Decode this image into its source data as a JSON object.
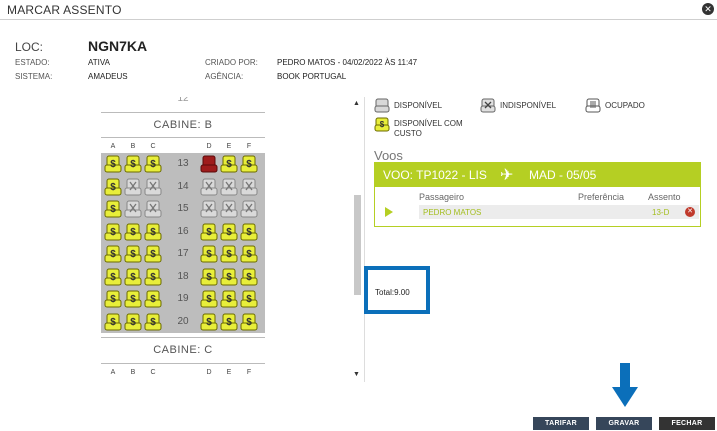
{
  "window": {
    "title": "MARCAR ASSENTO",
    "close_icon": "close-circle-icon"
  },
  "booking": {
    "loc_label": "LOC:",
    "loc_value": "NGN7KA",
    "estado_label": "ESTADO:",
    "estado_value": "ATIVA",
    "sistema_label": "SISTEMA:",
    "sistema_value": "AMADEUS",
    "criado_label": "CRIADO POR:",
    "criado_value": "PEDRO MATOS - 04/02/2022 ÀS 11:47",
    "agencia_label": "AGÊNCIA:",
    "agencia_value": "BOOK PORTUGAL"
  },
  "seatmap": {
    "cabin_label": "CABINE: B",
    "next_cabin_label": "CABINE: C",
    "top_partial_row": "12",
    "columns_left": [
      "A",
      "B",
      "C"
    ],
    "columns_right": [
      "D",
      "E",
      "F"
    ],
    "rows": [
      {
        "number": "13",
        "seats": [
          "custo",
          "custo",
          "custo",
          "ocupado",
          "custo",
          "custo"
        ]
      },
      {
        "number": "14",
        "seats": [
          "custo",
          "indisponivel",
          "indisponivel",
          "indisponivel",
          "indisponivel",
          "indisponivel"
        ]
      },
      {
        "number": "15",
        "seats": [
          "custo",
          "indisponivel",
          "indisponivel",
          "indisponivel",
          "indisponivel",
          "indisponivel"
        ]
      },
      {
        "number": "16",
        "seats": [
          "custo",
          "custo",
          "custo",
          "custo",
          "custo",
          "custo"
        ]
      },
      {
        "number": "17",
        "seats": [
          "custo",
          "custo",
          "custo",
          "custo",
          "custo",
          "custo"
        ]
      },
      {
        "number": "18",
        "seats": [
          "custo",
          "custo",
          "custo",
          "custo",
          "custo",
          "custo"
        ]
      },
      {
        "number": "19",
        "seats": [
          "custo",
          "custo",
          "custo",
          "custo",
          "custo",
          "custo"
        ]
      },
      {
        "number": "20",
        "seats": [
          "custo",
          "custo",
          "custo",
          "custo",
          "custo",
          "custo"
        ]
      }
    ]
  },
  "legend": {
    "disponivel": "DISPONÍVEL",
    "indisponivel": "INDISPONÍVEL",
    "ocupado": "OCUPADO",
    "custo_line1": "DISPONÍVEL COM",
    "custo_line2": "CUSTO"
  },
  "flights": {
    "title": "Voos",
    "origin": "VOO: TP1022 - LIS",
    "destination": "MAD - 05/05",
    "col_passenger": "Passageiro",
    "col_preference": "Preferência",
    "col_seat": "Assento",
    "passenger_name": "PEDRO MATOS",
    "passenger_seat": "13-D"
  },
  "total": {
    "text": "Total:9.00"
  },
  "buttons": {
    "tarifar": "TARIFAR",
    "gravar": "GRAVAR",
    "fechar": "FECHAR"
  },
  "colors": {
    "accent": "#b5cf23",
    "highlight_box": "#0b6fba",
    "seat_custo": "#e8ee3a",
    "seat_ocupado": "#9e1b1b",
    "button": "#36465a"
  }
}
